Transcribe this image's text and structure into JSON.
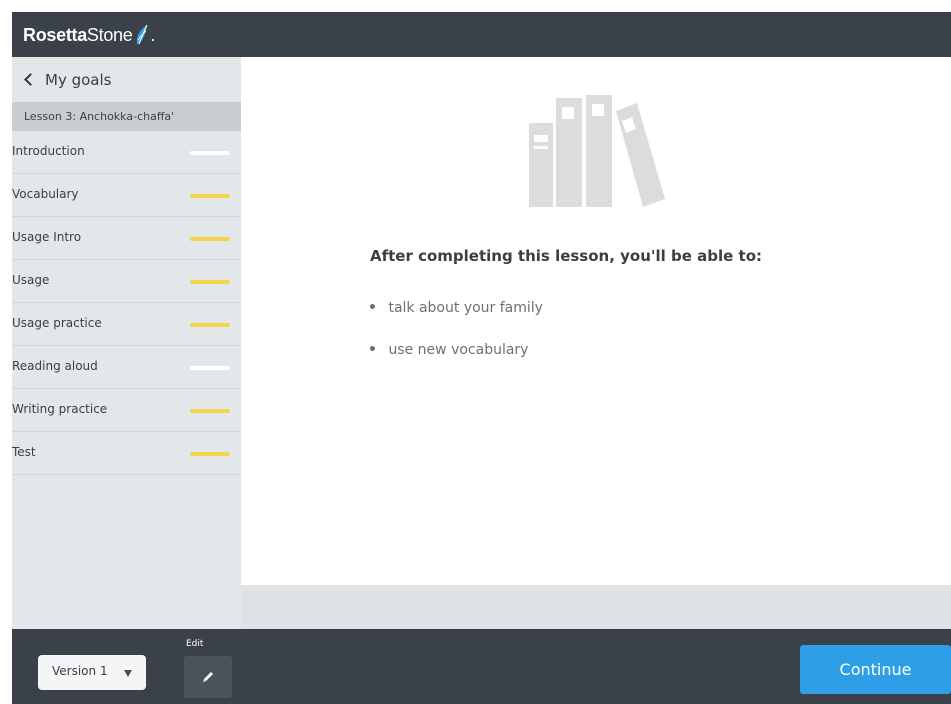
{
  "header": {
    "logo_bold": "Rosetta",
    "logo_thin": "Stone",
    "logo_mark": "."
  },
  "sidebar": {
    "back_label": "My goals",
    "lesson_title": "Lesson 3: Anchokka-chaffa'",
    "items": [
      {
        "label": "Introduction",
        "progress_color": "#ffffff"
      },
      {
        "label": "Vocabulary",
        "progress_color": "#f3d64b"
      },
      {
        "label": "Usage Intro",
        "progress_color": "#f3d64b"
      },
      {
        "label": "Usage",
        "progress_color": "#f3d64b"
      },
      {
        "label": "Usage practice",
        "progress_color": "#f3d64b"
      },
      {
        "label": "Reading aloud",
        "progress_color": "#ffffff"
      },
      {
        "label": "Writing practice",
        "progress_color": "#f3d64b"
      },
      {
        "label": "Test",
        "progress_color": "#f3d64b"
      }
    ]
  },
  "main": {
    "illustration_icon": "books-icon",
    "heading": "After completing this lesson, you'll be able to:",
    "goals": [
      "talk about your family",
      "use new vocabulary"
    ]
  },
  "footer": {
    "version_label": "Version 1",
    "edit_label": "Edit",
    "edit_icon": "pencil-icon",
    "continue_label": "Continue"
  },
  "colors": {
    "dark_bar": "#3b4149",
    "sidebar_bg": "#e4e7ea",
    "accent_blue": "#2e9fe6",
    "progress_yellow": "#f3d64b"
  }
}
